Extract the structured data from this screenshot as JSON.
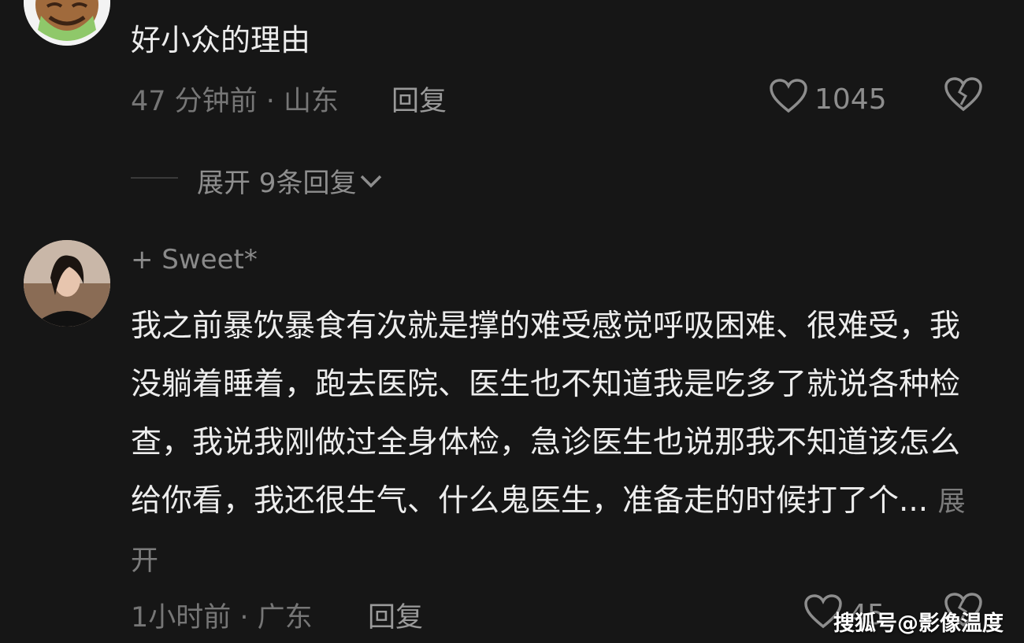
{
  "comments": [
    {
      "text": "好小众的理由",
      "meta": "47 分钟前 · 山东",
      "reply_label": "回复",
      "likes": "1045",
      "expand_label": "展开 9条回复"
    },
    {
      "username": "+ Sweet*",
      "text": "我之前暴饮暴食有次就是撑的难受感觉呼吸困难、很难受，我没躺着睡着，跑去医院、医生也不知道我是吃多了就说各种检查，我说我刚做过全身体检，急诊医生也说那我不知道该怎么给你看，我还很生气、什么鬼医生，准备走的时候打了个...",
      "more_label": "展开",
      "meta": "1小时前 · 广东",
      "reply_label": "回复",
      "likes": "45"
    }
  ],
  "watermark": "搜狐号@影像温度",
  "icons": [
    "heart-outline-icon",
    "broken-heart-icon",
    "chevron-down-icon"
  ],
  "colors": {
    "background": "#161616",
    "text": "#ededed",
    "muted": "#767676"
  }
}
